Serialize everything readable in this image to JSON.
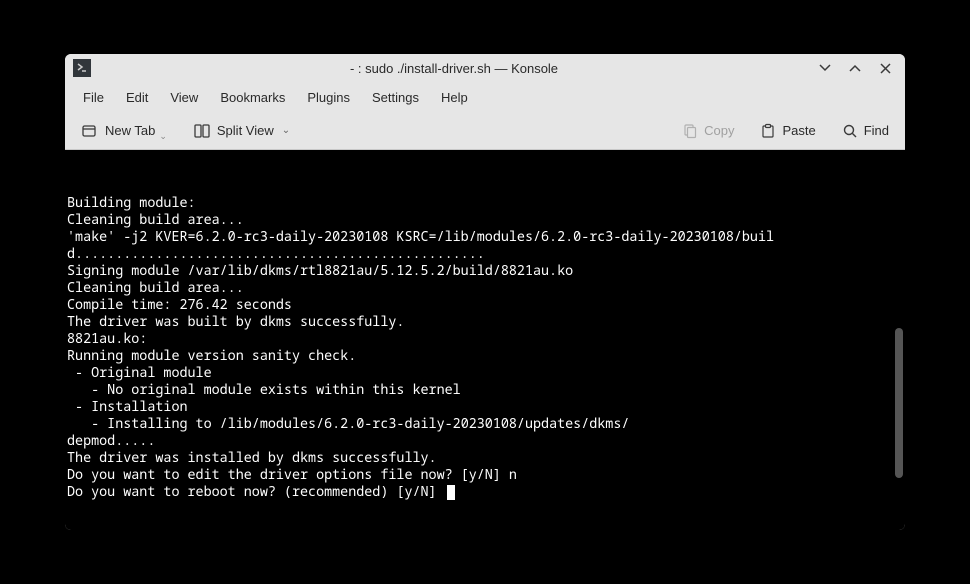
{
  "titlebar": {
    "title": "- : sudo ./install-driver.sh — Konsole"
  },
  "menubar": {
    "items": [
      "File",
      "Edit",
      "View",
      "Bookmarks",
      "Plugins",
      "Settings",
      "Help"
    ]
  },
  "toolbar": {
    "new_tab": "New Tab",
    "split_view": "Split View",
    "copy": "Copy",
    "paste": "Paste",
    "find": "Find"
  },
  "terminal": {
    "lines": [
      "Building module:",
      "Cleaning build area...",
      "'make' -j2 KVER=6.2.0-rc3-daily-20230108 KSRC=/lib/modules/6.2.0-rc3-daily-20230108/build...................................................",
      "Signing module /var/lib/dkms/rtl8821au/5.12.5.2/build/8821au.ko",
      "Cleaning build area...",
      "Compile time: 276.42 seconds",
      "The driver was built by dkms successfully.",
      "",
      "8821au.ko:",
      "Running module version sanity check.",
      " - Original module",
      "   - No original module exists within this kernel",
      " - Installation",
      "   - Installing to /lib/modules/6.2.0-rc3-daily-20230108/updates/dkms/",
      "depmod.....",
      "The driver was installed by dkms successfully.",
      "Do you want to edit the driver options file now? [y/N] n",
      "Do you want to reboot now? (recommended) [y/N] "
    ]
  }
}
